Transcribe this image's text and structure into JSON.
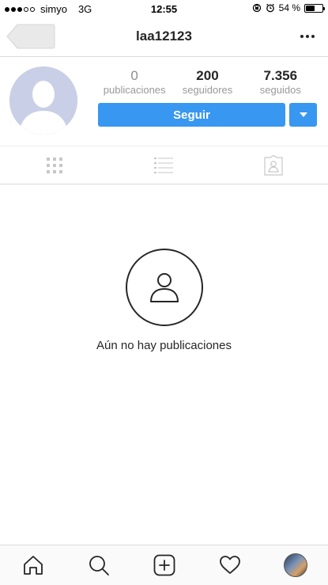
{
  "status_bar": {
    "carrier": "simyo",
    "network": "3G",
    "time": "12:55",
    "battery_text": "54 %",
    "battery_level": 0.54,
    "signal_bars_filled": 3,
    "signal_bars_total": 5
  },
  "nav": {
    "title": "laa12123",
    "back_icon": "back-arrow-icon",
    "more_icon": "more-dots-icon"
  },
  "profile": {
    "avatar_icon": "default-avatar-icon",
    "stats": [
      {
        "value": "0",
        "label": "publicaciones"
      },
      {
        "value": "200",
        "label": "seguidores"
      },
      {
        "value": "7.356",
        "label": "seguidos"
      }
    ],
    "follow_label": "Seguir",
    "dropdown_icon": "caret-down-icon"
  },
  "tabs": [
    {
      "icon": "grid-icon"
    },
    {
      "icon": "list-icon"
    },
    {
      "icon": "tagged-icon"
    }
  ],
  "empty_state": {
    "icon": "person-outline-icon",
    "text": "Aún no hay publicaciones"
  },
  "bottom_nav": [
    {
      "icon": "home-icon"
    },
    {
      "icon": "search-icon"
    },
    {
      "icon": "add-post-icon"
    },
    {
      "icon": "heart-icon"
    },
    {
      "icon": "profile-thumbnail"
    }
  ],
  "colors": {
    "accent": "#3897f0",
    "text": "#262626",
    "muted": "#999999",
    "avatar_bg": "#c9cfe6"
  }
}
